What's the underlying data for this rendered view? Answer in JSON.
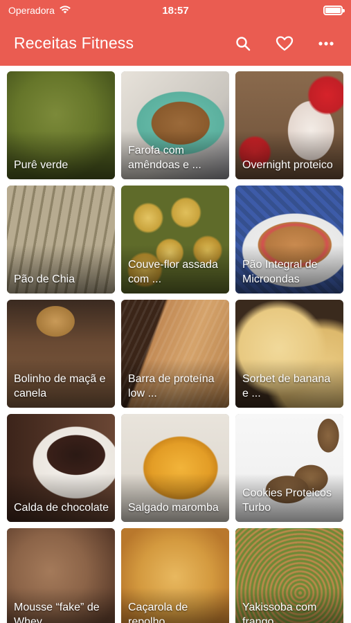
{
  "status_bar": {
    "carrier": "Operadora",
    "time": "18:57"
  },
  "app_bar": {
    "title": "Receitas Fitness",
    "icons": [
      "search-icon",
      "heart-icon",
      "more-icon"
    ]
  },
  "colors": {
    "primary": "#ea5c51",
    "text_on_primary": "#ffffff"
  },
  "recipes": [
    {
      "title": "Purê verde"
    },
    {
      "title": "Farofa com amêndoas e ..."
    },
    {
      "title": "Overnight proteico"
    },
    {
      "title": "Pão de Chia"
    },
    {
      "title": " Couve-flor assada com ..."
    },
    {
      "title": "Pão Integral de Microondas"
    },
    {
      "title": "Bolinho de maçã e canela"
    },
    {
      "title": "Barra de proteína low ..."
    },
    {
      "title": "Sorbet de banana e ..."
    },
    {
      "title": "Calda de chocolate"
    },
    {
      "title": "Salgado maromba"
    },
    {
      "title": "Cookies Proteicos Turbo"
    },
    {
      "title": "Mousse “fake” de Whey"
    },
    {
      "title": "Caçarola de repolho"
    },
    {
      "title": "Yakissoba com frango"
    }
  ]
}
